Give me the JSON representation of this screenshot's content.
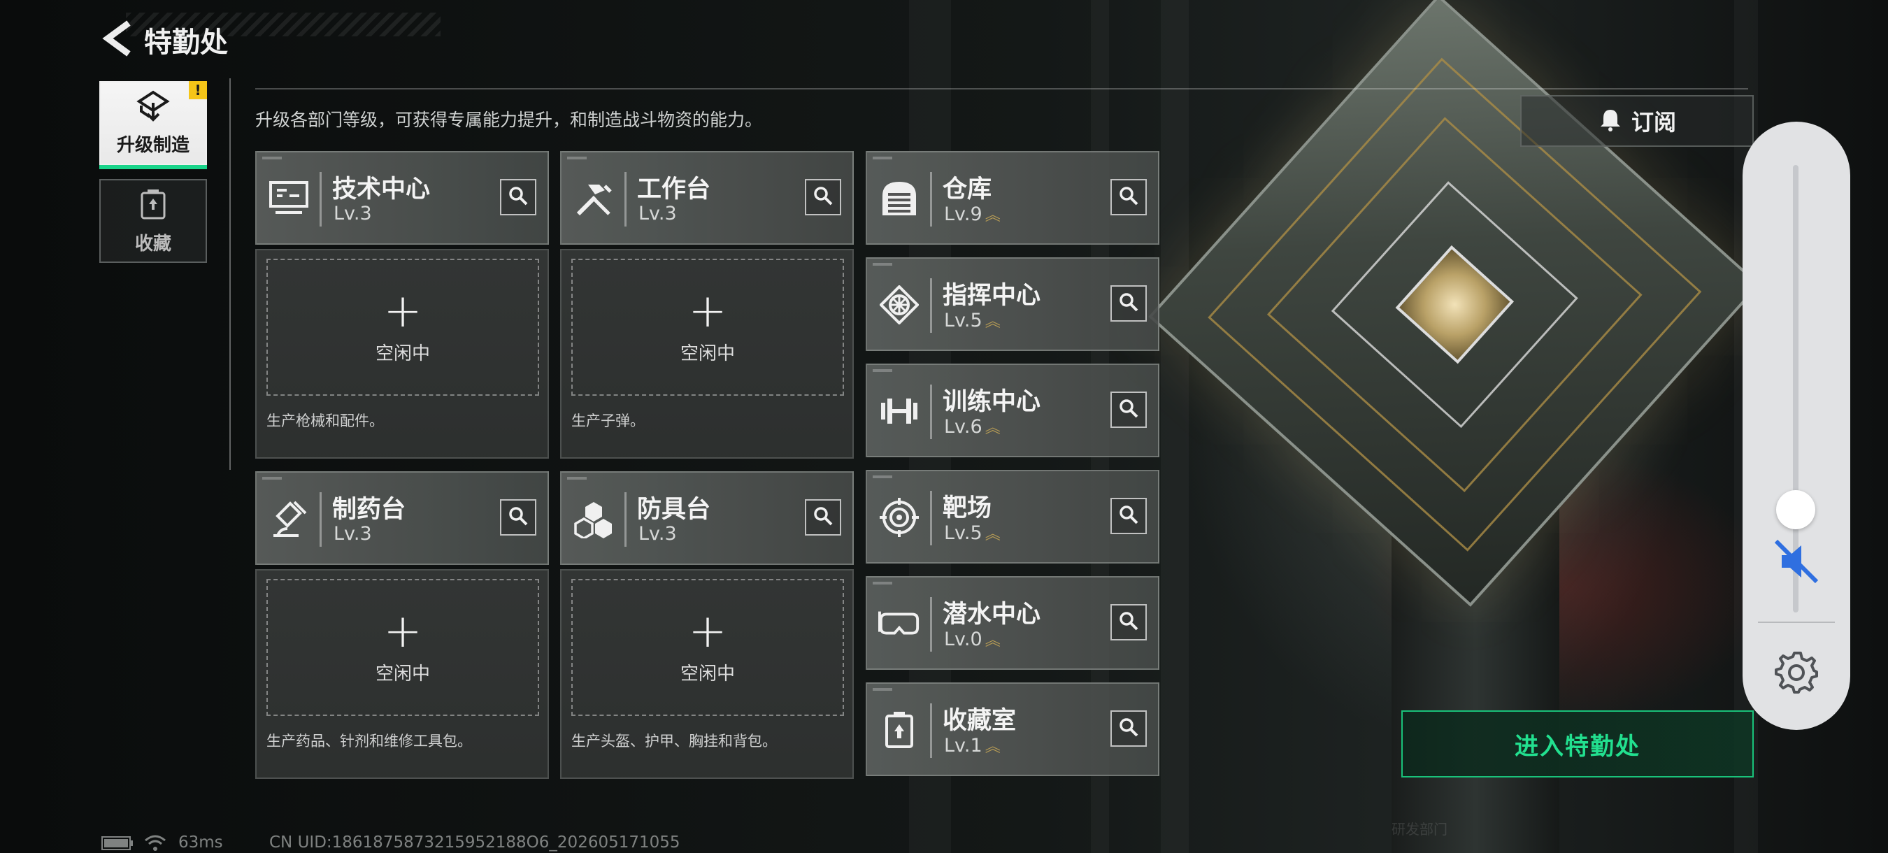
{
  "header": {
    "title": "特勤处",
    "back_icon": "back-arrow-icon"
  },
  "side_tabs": [
    {
      "label": "升级制造",
      "icon": "upgrade-icon",
      "active": true,
      "alert": "!"
    },
    {
      "label": "收藏",
      "icon": "collection-icon",
      "active": false
    }
  ],
  "description": "升级各部门等级，可获得专属能力提升，和制造战斗物资的能力。",
  "production": [
    {
      "name": "技术中心",
      "level": "Lv.3",
      "icon": "tech-center-icon",
      "slot_status": "空闲中",
      "desc": "生产枪械和配件。"
    },
    {
      "name": "工作台",
      "level": "Lv.3",
      "icon": "workbench-icon",
      "slot_status": "空闲中",
      "desc": "生产子弹。"
    },
    {
      "name": "制药台",
      "level": "Lv.3",
      "icon": "pharmacy-icon",
      "slot_status": "空闲中",
      "desc": "生产药品、针剂和维修工具包。"
    },
    {
      "name": "防具台",
      "level": "Lv.3",
      "icon": "armor-bench-icon",
      "slot_status": "空闲中",
      "desc": "生产头盔、护甲、胸挂和背包。"
    }
  ],
  "facilities": [
    {
      "name": "仓库",
      "level": "Lv.9",
      "icon": "warehouse-icon",
      "upgrade_available": true
    },
    {
      "name": "指挥中心",
      "level": "Lv.5",
      "icon": "command-center-icon",
      "upgrade_available": true
    },
    {
      "name": "训练中心",
      "level": "Lv.6",
      "icon": "training-center-icon",
      "upgrade_available": true
    },
    {
      "name": "靶场",
      "level": "Lv.5",
      "icon": "shooting-range-icon",
      "upgrade_available": true
    },
    {
      "name": "潜水中心",
      "level": "Lv.0",
      "icon": "diving-center-icon",
      "upgrade_available": true
    },
    {
      "name": "收藏室",
      "level": "Lv.1",
      "icon": "collection-room-icon",
      "upgrade_available": true
    }
  ],
  "subscribe": {
    "label": "订阅",
    "icon": "bell-icon"
  },
  "enter_button": {
    "label": "进入特勤处"
  },
  "volume_panel": {
    "level": 0.23,
    "muted": true
  },
  "status": {
    "ping": "63ms",
    "uid": "CN UID:1861875873215952188O6_202605171055"
  },
  "background_sign": "研发部门",
  "colors": {
    "accent": "#19d48a",
    "alert": "#f5c518",
    "upgrade_arrow": "#b49a55",
    "panel": "#e1e2e4"
  }
}
